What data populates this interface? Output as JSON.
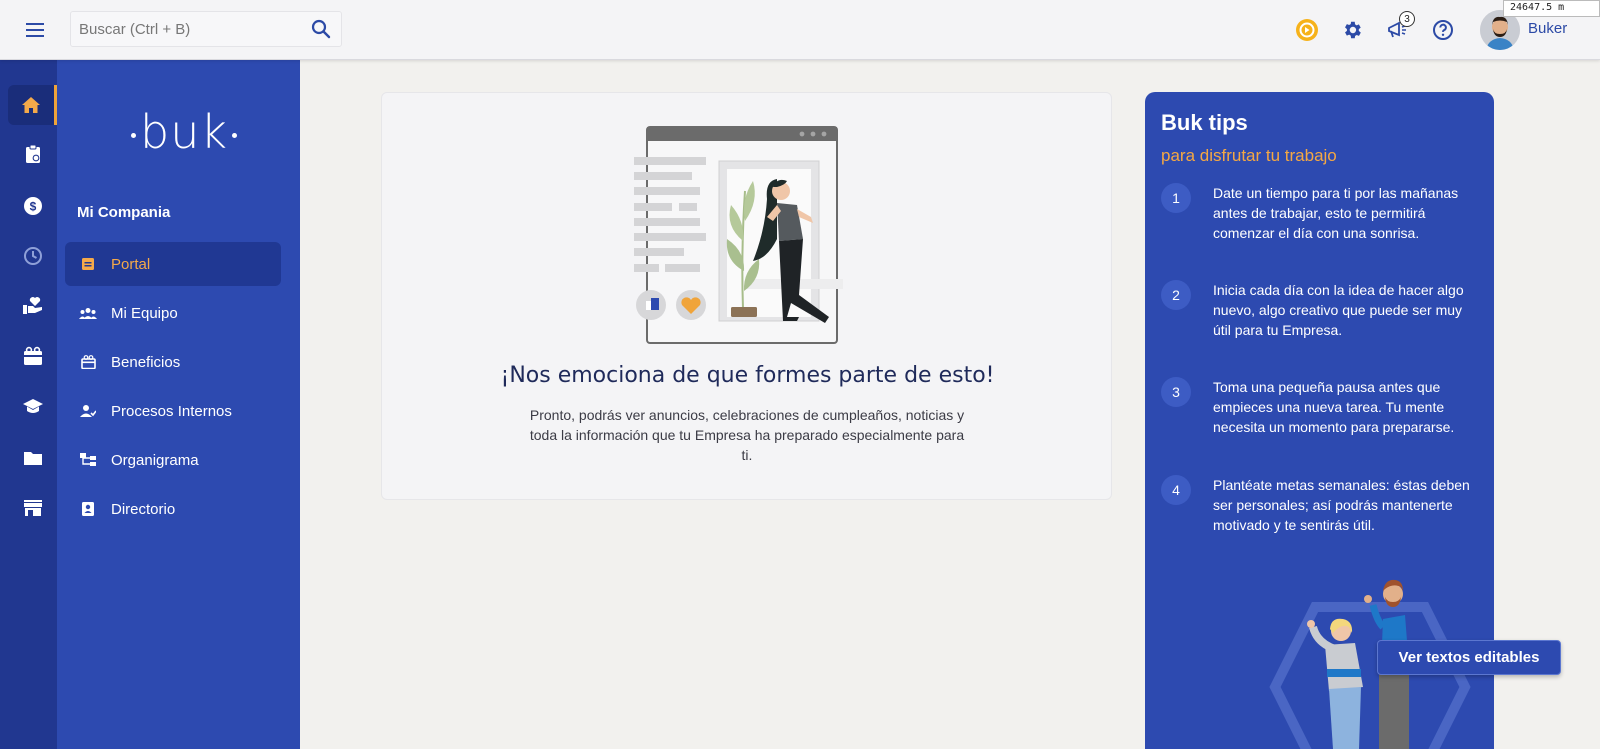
{
  "topbar": {
    "search_placeholder": "Buscar (Ctrl + B)",
    "notification_count": "3",
    "user_name": "Buker",
    "corner_tag": "24647.5 m"
  },
  "colors": {
    "brand_blue": "#2d4ab0",
    "rail_blue": "#213790",
    "accent_orange": "#f0a43a"
  },
  "rail": {
    "icons": [
      "home-icon",
      "clipboard-icon",
      "dollar-icon",
      "clock-icon",
      "hand-heart-icon",
      "gift-icon",
      "graduation-cap-icon",
      "folder-icon",
      "store-icon"
    ]
  },
  "sidebar": {
    "logo": "buk",
    "company": "Mi Compania",
    "items": [
      {
        "label": "Portal",
        "icon": "portal-icon"
      },
      {
        "label": "Mi Equipo",
        "icon": "team-icon"
      },
      {
        "label": "Beneficios",
        "icon": "gift-icon"
      },
      {
        "label": "Procesos Internos",
        "icon": "person-process-icon"
      },
      {
        "label": "Organigrama",
        "icon": "org-chart-icon"
      },
      {
        "label": "Directorio",
        "icon": "directory-icon"
      }
    ]
  },
  "main": {
    "title": "¡Nos emociona de que formes parte de esto!",
    "text": "Pronto, podrás ver anuncios, celebraciones de cumpleaños, noticias y toda la información que tu Empresa ha preparado especialmente para ti."
  },
  "tips": {
    "title": "Buk tips",
    "subtitle": "para disfrutar tu trabajo",
    "items": [
      {
        "num": "1",
        "text": "Date un tiempo para ti por las mañanas antes de trabajar, esto te permitirá comenzar el día con una sonrisa."
      },
      {
        "num": "2",
        "text": "Inicia cada día con la idea de hacer algo nuevo, algo creativo que puede ser muy útil para tu Empresa."
      },
      {
        "num": "3",
        "text": "Toma una pequeña pausa antes que empieces una nueva tarea. Tu mente necesita un momento para prepararse."
      },
      {
        "num": "4",
        "text": "Plantéate metas semanales: éstas deben ser personales; así podrás mantenerte motivado y te sentirás útil."
      }
    ]
  },
  "edit_button": "Ver textos editables"
}
